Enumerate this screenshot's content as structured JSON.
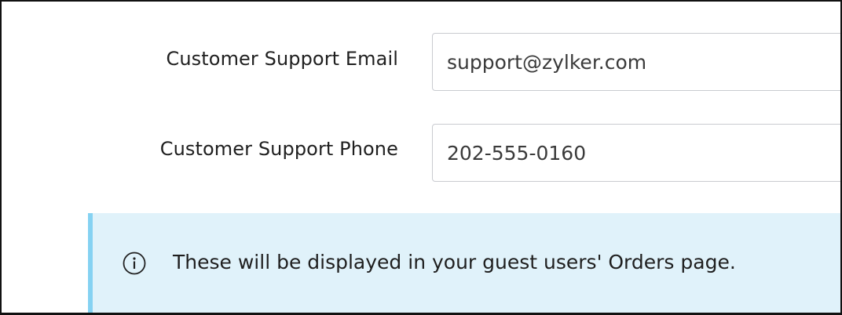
{
  "form": {
    "email": {
      "label": "Customer Support Email",
      "value": "support@zylker.com"
    },
    "phone": {
      "label": "Customer Support Phone",
      "value": "202-555-0160"
    }
  },
  "notice": {
    "icon": "info-icon",
    "text": "These will be displayed in your guest users' Orders page."
  },
  "colors": {
    "notice_background": "#e0f2fa",
    "notice_accent": "#85d2f2",
    "input_border": "#c9cbd0"
  }
}
